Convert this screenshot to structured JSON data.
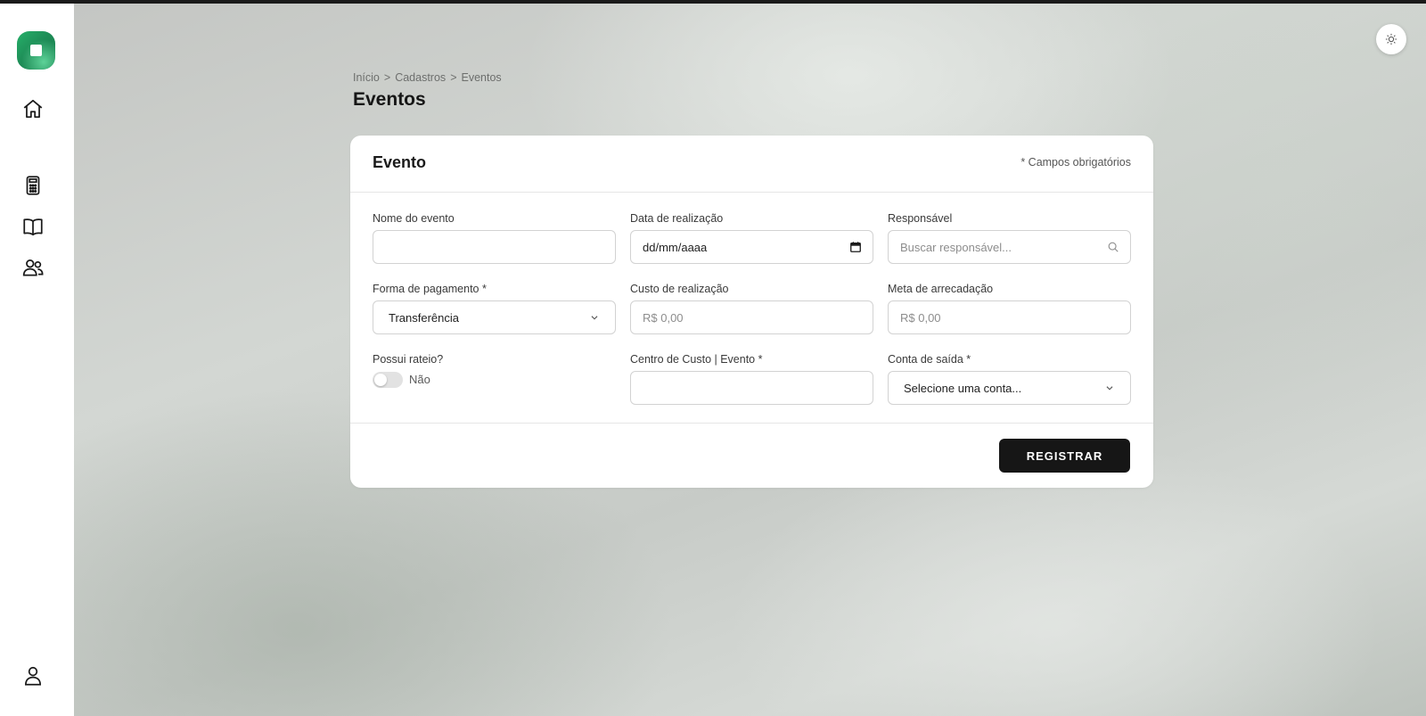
{
  "sidebar": {
    "items": [
      {
        "name": "home-icon"
      },
      {
        "name": "calculator-icon"
      },
      {
        "name": "book-icon"
      },
      {
        "name": "users-icon"
      }
    ],
    "bottom": {
      "name": "user-icon"
    }
  },
  "breadcrumb": {
    "items": [
      "Início",
      "Cadastros",
      "Eventos"
    ],
    "separator": ">"
  },
  "page": {
    "title": "Eventos"
  },
  "card": {
    "title": "Evento",
    "required_note": "* Campos obrigatórios"
  },
  "form": {
    "nome": {
      "label": "Nome do evento",
      "value": ""
    },
    "data": {
      "label": "Data de realização",
      "value": "dd/mm/aaaa"
    },
    "responsavel": {
      "label": "Responsável",
      "placeholder": "Buscar responsável..."
    },
    "pagamento": {
      "label": "Forma de pagamento *",
      "value": "Transferência"
    },
    "custo": {
      "label": "Custo de realização",
      "placeholder": "R$ 0,00"
    },
    "meta": {
      "label": "Meta de arrecadação",
      "placeholder": "R$ 0,00"
    },
    "rateio": {
      "label": "Possui rateio?",
      "toggle_label": "Não",
      "enabled": false
    },
    "centro": {
      "label": "Centro de Custo | Evento *",
      "value": ""
    },
    "conta": {
      "label": "Conta de saída *",
      "value": "Selecione uma conta..."
    }
  },
  "actions": {
    "register_label": "REGISTRAR"
  },
  "colors": {
    "accent": "#1e8d57",
    "button": "#161616"
  }
}
